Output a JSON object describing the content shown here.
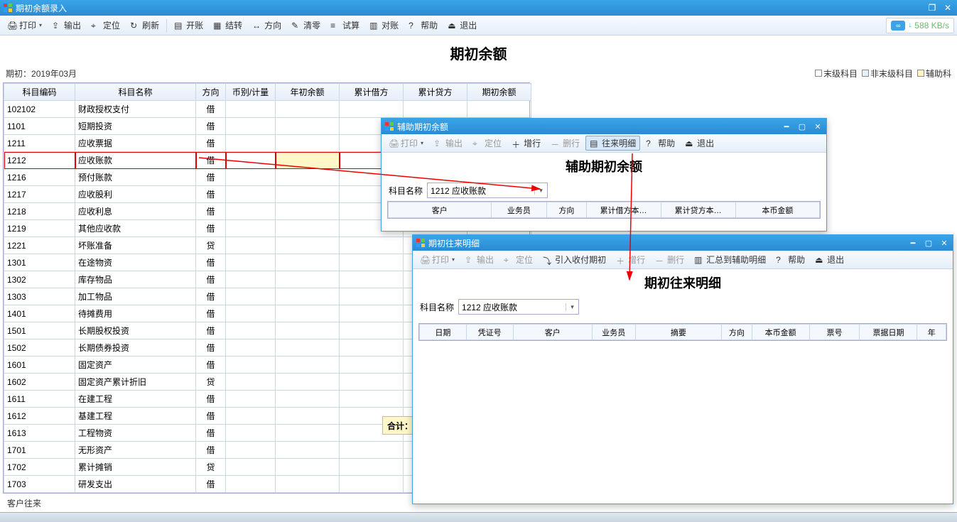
{
  "main": {
    "title": "期初余额录入",
    "toolbar": {
      "print": "打印",
      "export": "输出",
      "locate": "定位",
      "refresh": "刷新",
      "open": "开账",
      "settle": "结转",
      "direction": "方向",
      "clear": "清零",
      "trial": "试算",
      "recon": "对账",
      "help": "帮助",
      "exit": "退出"
    },
    "net_speed": "588 KB/s",
    "page_title": "期初余额",
    "period_label": "期初：",
    "period_value": "2019年03月",
    "legend": {
      "leaf": "末级科目",
      "nonleaf": "非末级科目",
      "aux": "辅助科"
    },
    "grid": {
      "headers": [
        "科目编码",
        "科目名称",
        "方向",
        "币别/计量",
        "年初余额",
        "累计借方",
        "累计贷方",
        "期初余额"
      ],
      "rows": [
        {
          "code": "102102",
          "name": "财政授权支付",
          "dir": "借"
        },
        {
          "code": "1101",
          "name": "短期投资",
          "dir": "借"
        },
        {
          "code": "1211",
          "name": "应收票据",
          "dir": "借"
        },
        {
          "code": "1212",
          "name": "应收账款",
          "dir": "借",
          "hl": true
        },
        {
          "code": "1216",
          "name": "预付账款",
          "dir": "借"
        },
        {
          "code": "1217",
          "name": "应收股利",
          "dir": "借"
        },
        {
          "code": "1218",
          "name": "应收利息",
          "dir": "借"
        },
        {
          "code": "1219",
          "name": "其他应收款",
          "dir": "借"
        },
        {
          "code": "1221",
          "name": "坏账准备",
          "dir": "贷"
        },
        {
          "code": "1301",
          "name": "在途物资",
          "dir": "借"
        },
        {
          "code": "1302",
          "name": "库存物品",
          "dir": "借"
        },
        {
          "code": "1303",
          "name": "加工物品",
          "dir": "借"
        },
        {
          "code": "1401",
          "name": "待摊费用",
          "dir": "借"
        },
        {
          "code": "1501",
          "name": "长期股权投资",
          "dir": "借"
        },
        {
          "code": "1502",
          "name": "长期债券投资",
          "dir": "借"
        },
        {
          "code": "1601",
          "name": "固定资产",
          "dir": "借"
        },
        {
          "code": "1602",
          "name": "固定资产累计折旧",
          "dir": "贷"
        },
        {
          "code": "1611",
          "name": "在建工程",
          "dir": "借"
        },
        {
          "code": "1612",
          "name": "基建工程",
          "dir": "借"
        },
        {
          "code": "1613",
          "name": "工程物资",
          "dir": "借"
        },
        {
          "code": "1701",
          "name": "无形资产",
          "dir": "借"
        },
        {
          "code": "1702",
          "name": "累计摊销",
          "dir": "贷"
        },
        {
          "code": "1703",
          "name": "研发支出",
          "dir": "借"
        }
      ]
    },
    "sum_label": "合计：",
    "status": "客户往来"
  },
  "popup1": {
    "title": "辅助期初余额",
    "toolbar": {
      "print": "打印",
      "export": "输出",
      "locate": "定位",
      "addrow": "增行",
      "delrow": "删行",
      "details": "往来明细",
      "help": "帮助",
      "exit": "退出"
    },
    "page_title": "辅助期初余额",
    "field_label": "科目名称",
    "field_value": "1212 应收账款",
    "headers": [
      "客户",
      "业务员",
      "方向",
      "累计借方本…",
      "累计贷方本…",
      "本币金额"
    ]
  },
  "popup2": {
    "title": "期初往来明细",
    "toolbar": {
      "print": "打印",
      "export": "输出",
      "locate": "定位",
      "import": "引入收付期初",
      "addrow": "增行",
      "delrow": "删行",
      "summary": "汇总到辅助明细",
      "help": "帮助",
      "exit": "退出"
    },
    "page_title": "期初往来明细",
    "field_label": "科目名称",
    "field_value": "1212 应收账款",
    "headers": [
      "日期",
      "凭证号",
      "客户",
      "业务员",
      "摘要",
      "方向",
      "本币金额",
      "票号",
      "票据日期",
      "年"
    ]
  }
}
